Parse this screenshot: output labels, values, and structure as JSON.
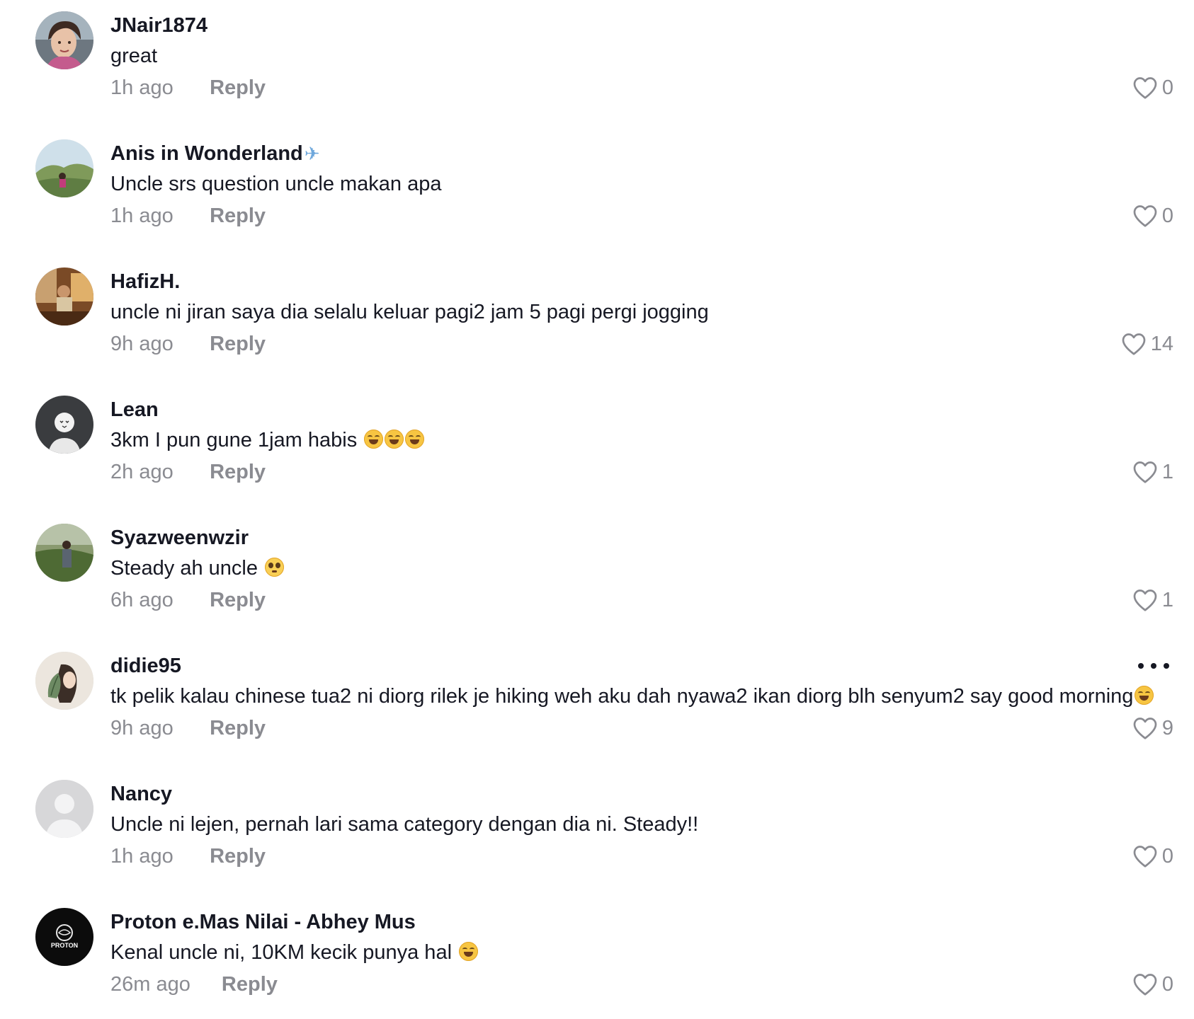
{
  "comments": [
    {
      "username": "JNair1874",
      "text": "great",
      "time": "1h ago",
      "reply_label": "Reply",
      "likes": "0",
      "avatar": "woman-portrait-avatar",
      "emoji": "",
      "has_more": false
    },
    {
      "username": "Anis in Wonderland",
      "username_icon": "airplane-emoji",
      "text": "Uncle srs question uncle makan apa",
      "time": "1h ago",
      "reply_label": "Reply",
      "likes": "0",
      "avatar": "hill-landscape-avatar",
      "emoji": "",
      "has_more": false
    },
    {
      "username": "HafizH.",
      "text": "uncle ni jiran saya dia selalu keluar pagi2 jam 5 pagi pergi jogging",
      "time": "9h ago",
      "reply_label": "Reply",
      "likes": "14",
      "avatar": "man-cafe-avatar",
      "emoji": "",
      "has_more": false
    },
    {
      "username": "Lean",
      "text": "3km I pun gune 1jam habis ",
      "time": "2h ago",
      "reply_label": "Reply",
      "likes": "1",
      "avatar": "dark-cartoon-avatar",
      "emoji": "tears-of-joy x3",
      "has_more": false
    },
    {
      "username": "Syazweenwzir",
      "text": "Steady ah uncle ",
      "time": "6h ago",
      "reply_label": "Reply",
      "likes": "1",
      "avatar": "outdoor-greenery-avatar",
      "emoji": "pleading-face",
      "has_more": false
    },
    {
      "username": "didie95",
      "text": "tk pelik kalau chinese tua2 ni diorg rilek je hiking weh aku dah nyawa2 ikan diorg blh senyum2 say good morning",
      "time": "9h ago",
      "reply_label": "Reply",
      "likes": "9",
      "avatar": "illustrated-woman-leaf-avatar",
      "emoji": "tears-of-joy",
      "has_more": true
    },
    {
      "username": "Nancy",
      "text": "Uncle ni lejen, pernah lari sama category dengan dia ni. Steady!!",
      "time": "1h ago",
      "reply_label": "Reply",
      "likes": "0",
      "avatar": "default-avatar",
      "emoji": "",
      "has_more": false
    },
    {
      "username": "Proton e.Mas Nilai - Abhey Mus",
      "text": "Kenal uncle ni, 10KM kecik punya hal ",
      "time": "26m ago",
      "reply_label": "Reply",
      "likes": "0",
      "avatar": "proton-logo-avatar",
      "emoji": "tears-of-joy",
      "has_more": false
    }
  ],
  "icons": {
    "like": "heart-outline-icon",
    "more": "more-horizontal-icon"
  },
  "colors": {
    "primary_text": "#161823",
    "secondary_text": "#8a8b91",
    "background": "#ffffff"
  },
  "logo_text": "PROTON"
}
